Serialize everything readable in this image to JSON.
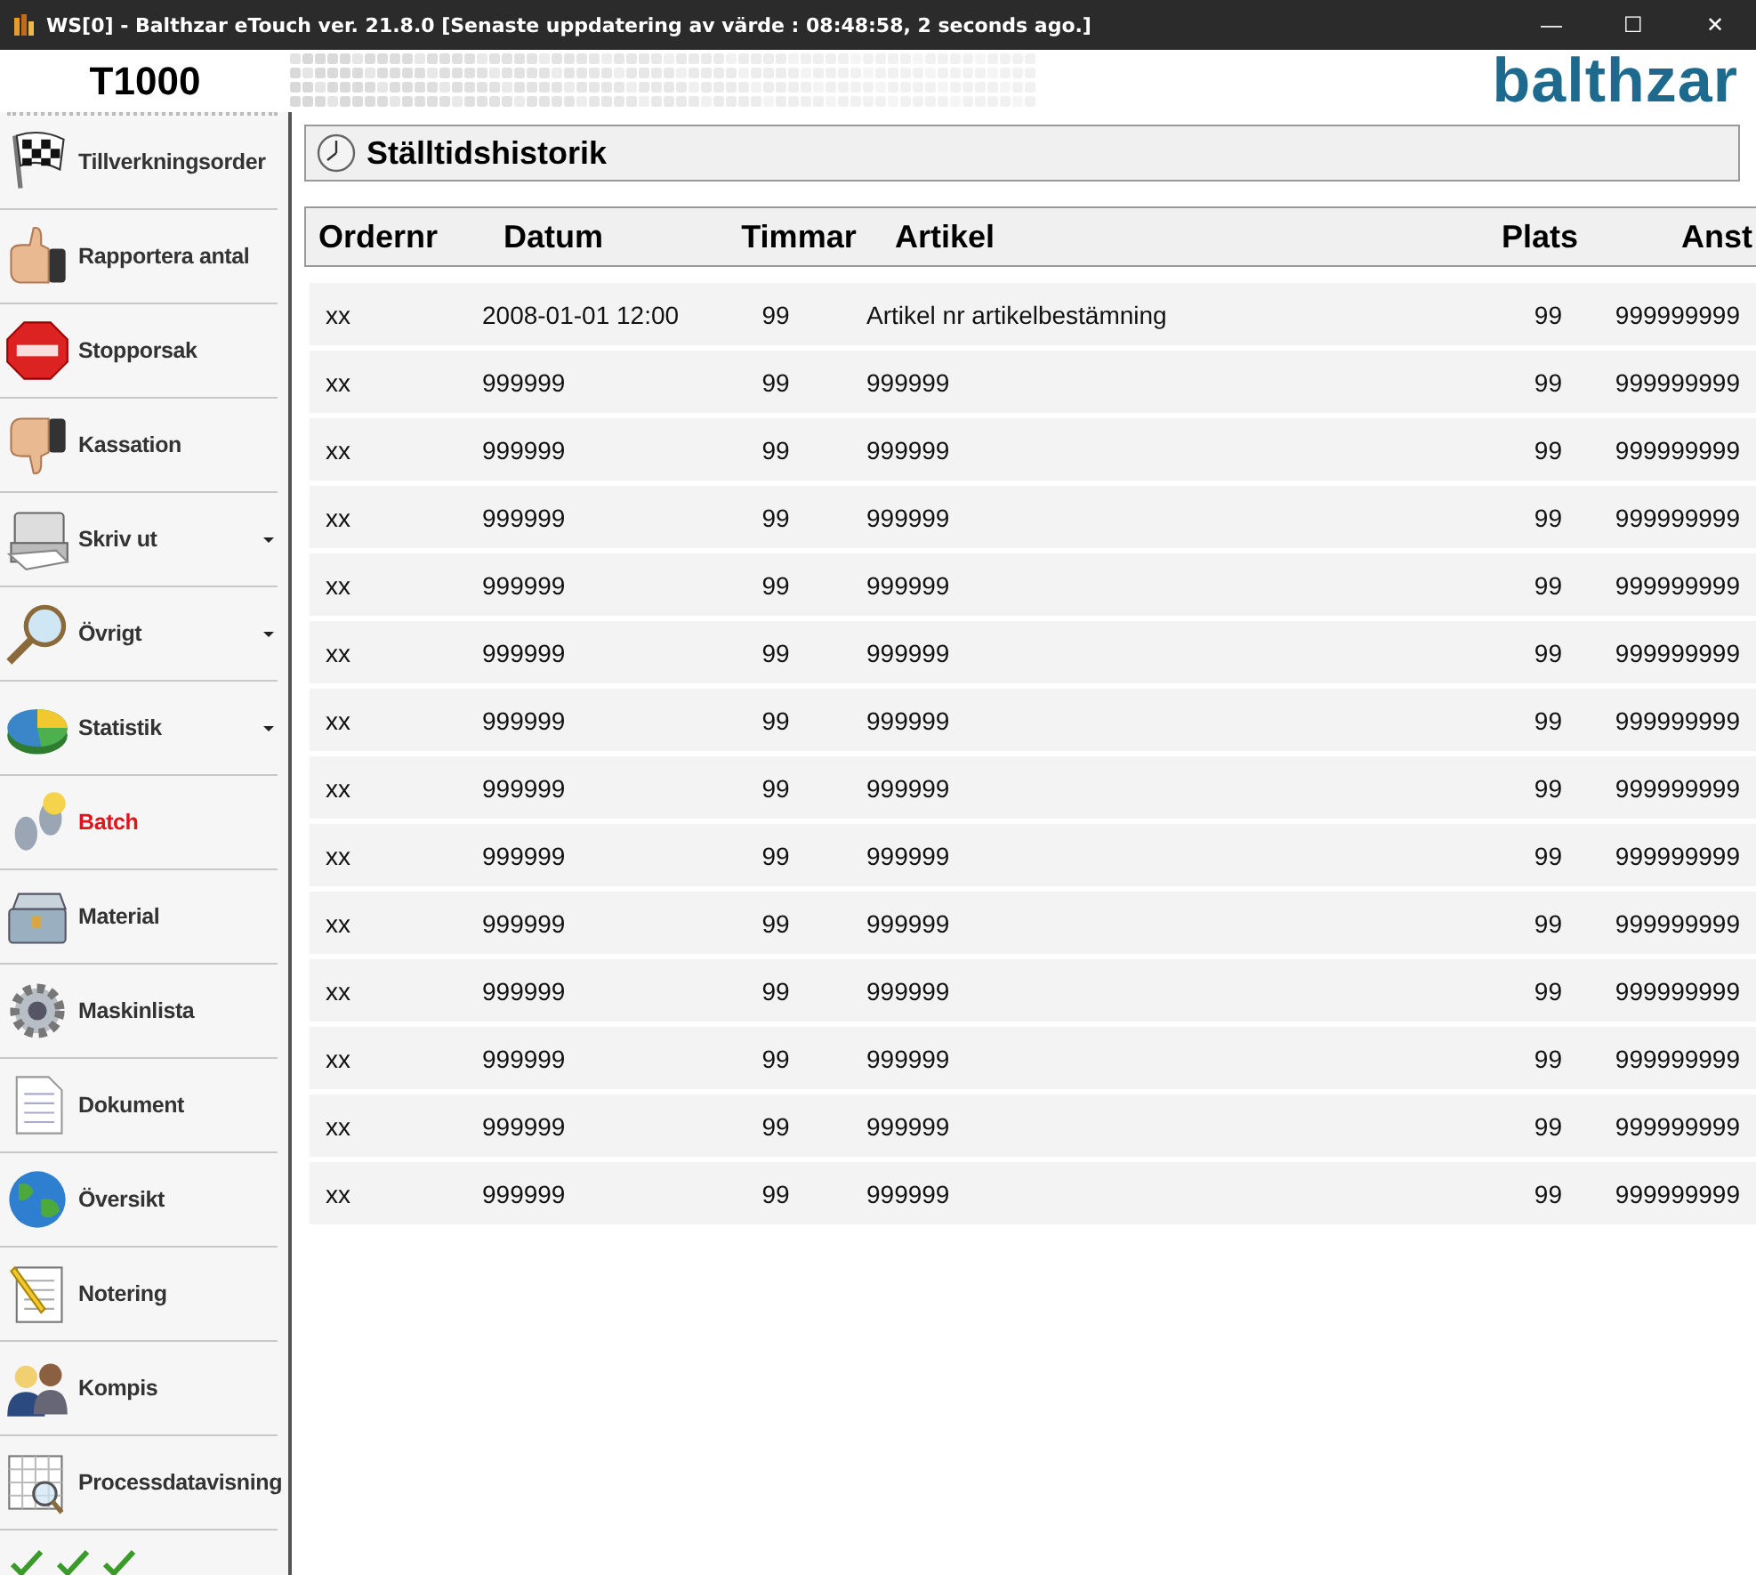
{
  "window": {
    "title": "WS[0] - Balthzar eTouch ver. 21.8.0  [Senaste uppdatering av värde : 08:48:58, 2 seconds ago.]",
    "controls": [
      "—",
      "☐",
      "✕"
    ]
  },
  "header": {
    "machine": "T1000",
    "logo": "balthzar"
  },
  "sidebar": {
    "items": [
      {
        "label": "Tillverkningsorder",
        "selected": false,
        "has_submenu": false
      },
      {
        "label": "Rapportera antal",
        "selected": false,
        "has_submenu": false
      },
      {
        "label": "Stopporsak",
        "selected": false,
        "has_submenu": false
      },
      {
        "label": "Kassation",
        "selected": false,
        "has_submenu": false
      },
      {
        "label": "Skriv ut",
        "selected": false,
        "has_submenu": true
      },
      {
        "label": "Övrigt",
        "selected": false,
        "has_submenu": true
      },
      {
        "label": "Statistik",
        "selected": false,
        "has_submenu": true
      },
      {
        "label": "Batch",
        "selected": true,
        "has_submenu": false
      },
      {
        "label": "Material",
        "selected": false,
        "has_submenu": false
      },
      {
        "label": "Maskinlista",
        "selected": false,
        "has_submenu": false
      },
      {
        "label": "Dokument",
        "selected": false,
        "has_submenu": false
      },
      {
        "label": "Översikt",
        "selected": false,
        "has_submenu": false
      },
      {
        "label": "Notering",
        "selected": false,
        "has_submenu": false
      },
      {
        "label": "Kompis",
        "selected": false,
        "has_submenu": false
      },
      {
        "label": "Processdatavisning",
        "selected": false,
        "has_submenu": false
      }
    ]
  },
  "panel": {
    "title": "Ställtidshistorik"
  },
  "table": {
    "columns": [
      "Ordernr",
      "Datum",
      "Timmar",
      "Artikel",
      "Plats",
      "Anst"
    ],
    "rows": [
      [
        "xx",
        "2008-01-01 12:00",
        "99",
        "Artikel nr artikelbestämning",
        "99",
        "999999999"
      ],
      [
        "xx",
        "999999",
        "99",
        "999999",
        "99",
        "999999999"
      ],
      [
        "xx",
        "999999",
        "99",
        "999999",
        "99",
        "999999999"
      ],
      [
        "xx",
        "999999",
        "99",
        "999999",
        "99",
        "999999999"
      ],
      [
        "xx",
        "999999",
        "99",
        "999999",
        "99",
        "999999999"
      ],
      [
        "xx",
        "999999",
        "99",
        "999999",
        "99",
        "999999999"
      ],
      [
        "xx",
        "999999",
        "99",
        "999999",
        "99",
        "999999999"
      ],
      [
        "xx",
        "999999",
        "99",
        "999999",
        "99",
        "999999999"
      ],
      [
        "xx",
        "999999",
        "99",
        "999999",
        "99",
        "999999999"
      ],
      [
        "xx",
        "999999",
        "99",
        "999999",
        "99",
        "999999999"
      ],
      [
        "xx",
        "999999",
        "99",
        "999999",
        "99",
        "999999999"
      ],
      [
        "xx",
        "999999",
        "99",
        "999999",
        "99",
        "999999999"
      ],
      [
        "xx",
        "999999",
        "99",
        "999999",
        "99",
        "999999999"
      ],
      [
        "xx",
        "999999",
        "99",
        "999999",
        "99",
        "999999999"
      ]
    ]
  }
}
